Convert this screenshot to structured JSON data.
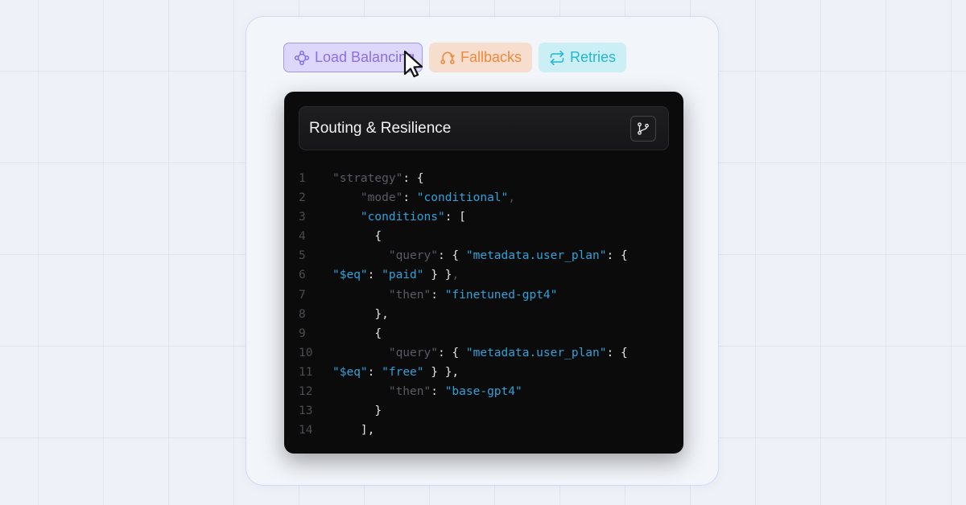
{
  "tabs": [
    {
      "id": "load-balancing",
      "label": "Load Balancing",
      "icon": "network-nodes-icon",
      "color": "#8b6ee6",
      "active": true
    },
    {
      "id": "fallbacks",
      "label": "Fallbacks",
      "icon": "fallback-arc-icon",
      "color": "#ef8a3c"
    },
    {
      "id": "retries",
      "label": "Retries",
      "icon": "repeat-icon",
      "color": "#22b6d6"
    }
  ],
  "panel": {
    "title": "Routing & Resilience",
    "action_icon": "git-branch-icon"
  },
  "code_lines": [
    {
      "n": "1",
      "indent": 0,
      "tokens": [
        [
          "k",
          "\"strategy\""
        ],
        [
          "p",
          ": {"
        ]
      ]
    },
    {
      "n": "2",
      "indent": 4,
      "tokens": [
        [
          "k",
          "\"mode\""
        ],
        [
          "p",
          ": "
        ],
        [
          "s",
          "\"conditional\""
        ],
        [
          "m",
          ","
        ]
      ]
    },
    {
      "n": "3",
      "indent": 4,
      "tokens": [
        [
          "s",
          "\"conditions\""
        ],
        [
          "p",
          ": ["
        ]
      ]
    },
    {
      "n": "4",
      "indent": 6,
      "tokens": [
        [
          "p",
          "{"
        ]
      ]
    },
    {
      "n": "5",
      "indent": 8,
      "tokens": [
        [
          "k",
          "\"query\""
        ],
        [
          "p",
          ": { "
        ],
        [
          "s",
          "\"metadata.user_plan\""
        ],
        [
          "p",
          ": {"
        ]
      ]
    },
    {
      "n": "6",
      "indent": 0,
      "tokens": [
        [
          "s",
          "\"$eq\""
        ],
        [
          "p",
          ": "
        ],
        [
          "s",
          "\"paid\""
        ],
        [
          "p",
          " } }"
        ],
        [
          "m",
          ","
        ]
      ]
    },
    {
      "n": "7",
      "indent": 8,
      "tokens": [
        [
          "k",
          "\"then\""
        ],
        [
          "p",
          ": "
        ],
        [
          "s",
          "\"finetuned-gpt4\""
        ]
      ]
    },
    {
      "n": "8",
      "indent": 6,
      "tokens": [
        [
          "p",
          "},"
        ]
      ]
    },
    {
      "n": "9",
      "indent": 6,
      "tokens": [
        [
          "p",
          "{"
        ]
      ]
    },
    {
      "n": "10",
      "indent": 8,
      "tokens": [
        [
          "k",
          "\"query\""
        ],
        [
          "p",
          ": { "
        ],
        [
          "s",
          "\"metadata.user_plan\""
        ],
        [
          "p",
          ": {"
        ]
      ]
    },
    {
      "n": "11",
      "indent": 0,
      "tokens": [
        [
          "s",
          "\"$eq\""
        ],
        [
          "p",
          ": "
        ],
        [
          "s",
          "\"free\""
        ],
        [
          "p",
          " } },"
        ]
      ]
    },
    {
      "n": "12",
      "indent": 8,
      "tokens": [
        [
          "k",
          "\"then\""
        ],
        [
          "p",
          ": "
        ],
        [
          "s",
          "\"base-gpt4\""
        ]
      ]
    },
    {
      "n": "13",
      "indent": 6,
      "tokens": [
        [
          "p",
          "}"
        ]
      ]
    },
    {
      "n": "14",
      "indent": 4,
      "tokens": [
        [
          "p",
          "],"
        ]
      ]
    }
  ]
}
